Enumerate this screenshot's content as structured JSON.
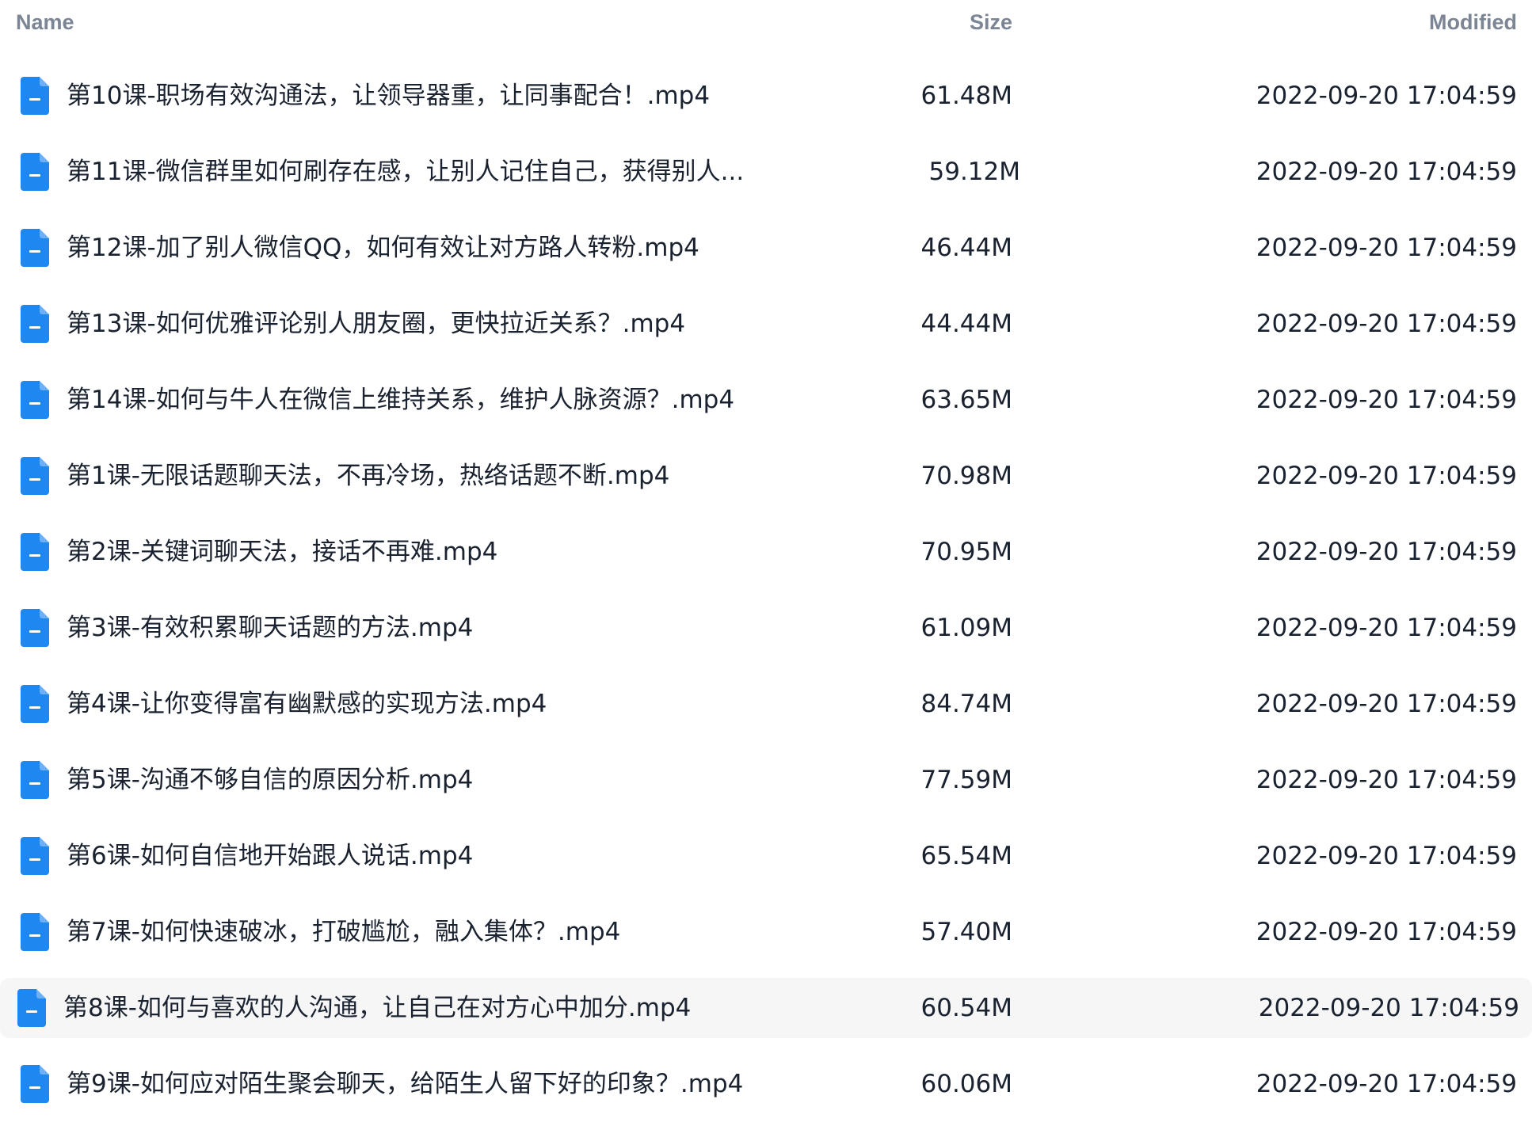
{
  "header": {
    "name_label": "Name",
    "size_label": "Size",
    "modified_label": "Modified"
  },
  "colors": {
    "accent": "#1e88f0",
    "selected_row": "#f6f6f7",
    "header_text": "#7b8594"
  },
  "files": [
    {
      "name": "第10课-职场有效沟通法，让领导器重，让同事配合！.mp4",
      "size": "61.48M",
      "modified": "2022-09-20 17:04:59",
      "icon": "file-icon",
      "selected": false
    },
    {
      "name": "第11课-微信群里如何刷存在感，让别人记住自己，获得别人...",
      "size": "59.12M",
      "modified": "2022-09-20 17:04:59",
      "icon": "file-icon",
      "selected": false
    },
    {
      "name": "第12课-加了别人微信QQ，如何有效让对方路人转粉.mp4",
      "size": "46.44M",
      "modified": "2022-09-20 17:04:59",
      "icon": "file-icon",
      "selected": false
    },
    {
      "name": "第13课-如何优雅评论别人朋友圈，更快拉近关系？.mp4",
      "size": "44.44M",
      "modified": "2022-09-20 17:04:59",
      "icon": "file-icon",
      "selected": false
    },
    {
      "name": "第14课-如何与牛人在微信上维持关系，维护人脉资源？.mp4",
      "size": "63.65M",
      "modified": "2022-09-20 17:04:59",
      "icon": "file-icon",
      "selected": false
    },
    {
      "name": "第1课-无限话题聊天法，不再冷场，热络话题不断.mp4",
      "size": "70.98M",
      "modified": "2022-09-20 17:04:59",
      "icon": "file-icon",
      "selected": false
    },
    {
      "name": "第2课-关键词聊天法，接话不再难.mp4",
      "size": "70.95M",
      "modified": "2022-09-20 17:04:59",
      "icon": "file-icon",
      "selected": false
    },
    {
      "name": "第3课-有效积累聊天话题的方法.mp4",
      "size": "61.09M",
      "modified": "2022-09-20 17:04:59",
      "icon": "file-icon",
      "selected": false
    },
    {
      "name": "第4课-让你变得富有幽默感的实现方法.mp4",
      "size": "84.74M",
      "modified": "2022-09-20 17:04:59",
      "icon": "file-icon",
      "selected": false
    },
    {
      "name": "第5课-沟通不够自信的原因分析.mp4",
      "size": "77.59M",
      "modified": "2022-09-20 17:04:59",
      "icon": "file-icon",
      "selected": false
    },
    {
      "name": "第6课-如何自信地开始跟人说话.mp4",
      "size": "65.54M",
      "modified": "2022-09-20 17:04:59",
      "icon": "file-icon",
      "selected": false
    },
    {
      "name": "第7课-如何快速破冰，打破尴尬，融入集体？.mp4",
      "size": "57.40M",
      "modified": "2022-09-20 17:04:59",
      "icon": "file-icon",
      "selected": false
    },
    {
      "name": "第8课-如何与喜欢的人沟通，让自己在对方心中加分.mp4",
      "size": "60.54M",
      "modified": "2022-09-20 17:04:59",
      "icon": "file-icon",
      "selected": true
    },
    {
      "name": "第9课-如何应对陌生聚会聊天，给陌生人留下好的印象？.mp4",
      "size": "60.06M",
      "modified": "2022-09-20 17:04:59",
      "icon": "file-icon",
      "selected": false
    }
  ]
}
